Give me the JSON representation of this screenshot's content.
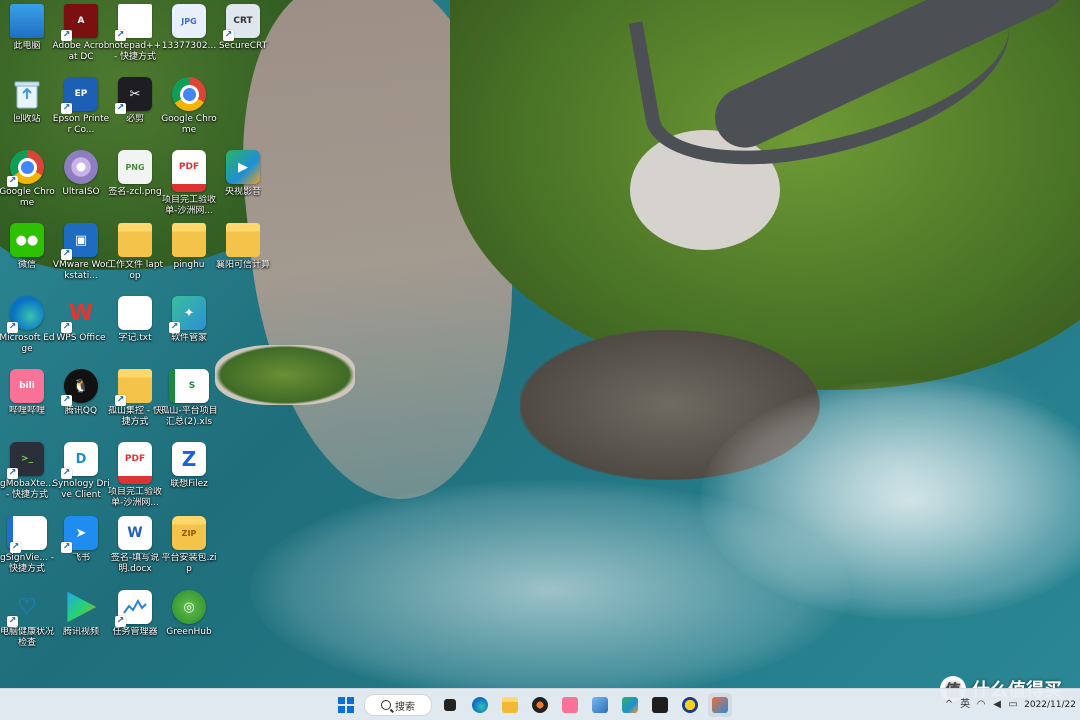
{
  "desktop": {
    "icons": [
      {
        "label": "此电脑",
        "icon": "monitor-icon"
      },
      {
        "label": "Adobe Acrobat DC",
        "icon": "pdf-icon"
      },
      {
        "label": "notepad++ - 快捷方式",
        "icon": "document-icon"
      },
      {
        "label": "13377302...",
        "icon": "jpg-file-icon"
      },
      {
        "label": "SecureCRT",
        "icon": "securecrt-icon"
      },
      {
        "label": "回收站",
        "icon": "recycle-bin-icon"
      },
      {
        "label": "Epson Printer Co...",
        "icon": "epson-icon"
      },
      {
        "label": "必剪",
        "icon": "bijian-icon"
      },
      {
        "label": "Google Chrome",
        "icon": "chrome-icon"
      },
      {
        "label": "Google Chrome",
        "icon": "chrome-icon"
      },
      {
        "label": "UltraISO",
        "icon": "disc-icon"
      },
      {
        "label": "签名-zcl.png",
        "icon": "png-file-icon"
      },
      {
        "label": "项目完工验收单-沙洲网...",
        "icon": "pdf-file-icon"
      },
      {
        "label": "央视影音",
        "icon": "player-icon"
      },
      {
        "label": "微信",
        "icon": "wechat-icon"
      },
      {
        "label": "VMware Workstati...",
        "icon": "vmware-icon"
      },
      {
        "label": "工作文件 laptop",
        "icon": "folder-icon"
      },
      {
        "label": "pinghu",
        "icon": "folder-icon"
      },
      {
        "label": "襄阳可信计算",
        "icon": "folder-icon"
      },
      {
        "label": "Microsoft Edge",
        "icon": "edge-icon"
      },
      {
        "label": "WPS Office",
        "icon": "wps-icon"
      },
      {
        "label": "字记.txt",
        "icon": "text-file-icon"
      },
      {
        "label": "软件管家",
        "icon": "software-manager-icon"
      },
      {
        "label": "哔哩哔哩",
        "icon": "bilibili-icon"
      },
      {
        "label": "腾讯QQ",
        "icon": "qq-icon"
      },
      {
        "label": "孤山集控 - 快捷方式",
        "icon": "folder-icon"
      },
      {
        "label": "孤山-平台项目汇总(2).xls",
        "icon": "excel-file-icon"
      },
      {
        "label": "gMobaXte... - 快捷方式",
        "icon": "mobaxterm-icon"
      },
      {
        "label": "Synology Drive Client",
        "icon": "synology-icon"
      },
      {
        "label": "项目完工验收单-沙洲网...",
        "icon": "pdf-file-icon"
      },
      {
        "label": "联想Filez",
        "icon": "filez-icon"
      },
      {
        "label": "gSignVie... - 快捷方式",
        "icon": "signview-icon"
      },
      {
        "label": "飞书",
        "icon": "feishu-icon"
      },
      {
        "label": "签名-填写说明.docx",
        "icon": "word-file-icon"
      },
      {
        "label": "平台安装包.zip",
        "icon": "zip-folder-icon"
      },
      {
        "label": "电脑健康状况检查",
        "icon": "health-check-icon"
      },
      {
        "label": "腾讯视频",
        "icon": "tencent-video-icon"
      },
      {
        "label": "任务管理器",
        "icon": "task-manager-icon"
      },
      {
        "label": "GreenHub",
        "icon": "greenhub-icon"
      }
    ]
  },
  "taskbar": {
    "search_label": "搜索",
    "pinned": [
      {
        "icon": "start-icon"
      },
      {
        "icon": "task-view-icon"
      },
      {
        "icon": "edge-icon"
      },
      {
        "icon": "file-explorer-icon"
      },
      {
        "icon": "media-player-icon"
      },
      {
        "icon": "bilibili-icon"
      },
      {
        "icon": "photos-icon"
      },
      {
        "icon": "player-icon"
      },
      {
        "icon": "terminal-icon"
      },
      {
        "icon": "xmanager-icon"
      },
      {
        "icon": "snipping-tool-icon"
      }
    ],
    "tray": {
      "language": "英",
      "date": "2022/11/22"
    }
  },
  "watermark": {
    "text": "什么值得买",
    "badge": "值"
  }
}
